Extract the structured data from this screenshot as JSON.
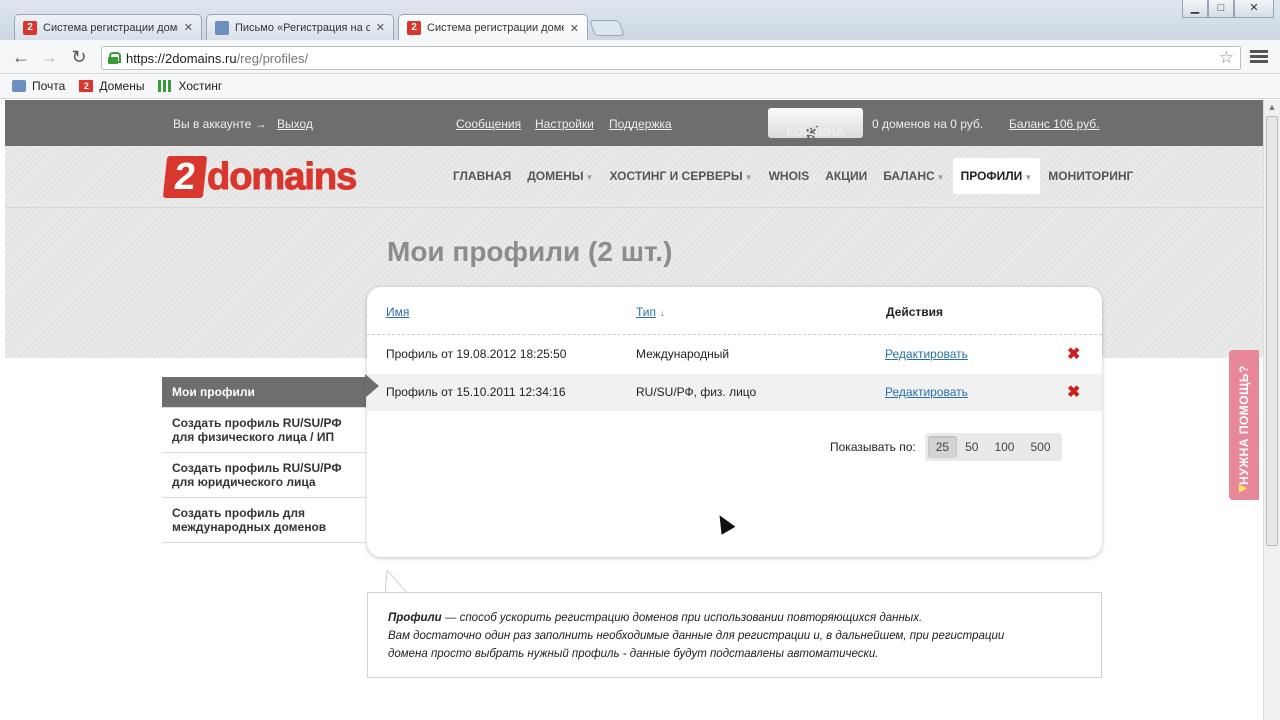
{
  "browser": {
    "tabs": [
      {
        "title": "Система регистрации доме",
        "icon": "two-icon",
        "active": false
      },
      {
        "title": "Письмо «Регистрация на с",
        "icon": "mail-icon",
        "active": false
      },
      {
        "title": "Система регистрации доме",
        "icon": "two-icon",
        "active": true
      }
    ],
    "favicon_letter": "2",
    "close_glyph": "✕",
    "window_controls": {
      "minimize": "▁",
      "maximize": "□",
      "close": "✕"
    },
    "url_host": "https://2domains.ru",
    "url_path": "/reg/profiles/",
    "bookmarks": [
      {
        "label": "Почта",
        "icon": "mail-icon"
      },
      {
        "label": "Домены",
        "icon": "two-icon"
      },
      {
        "label": "Хостинг",
        "icon": "hosting-icon"
      }
    ]
  },
  "topbar": {
    "account_text": "Вы в аккаунте →",
    "logout": "Выход",
    "messages": "Сообщения",
    "settings": "Настройки",
    "support": "Поддержка",
    "cart_label": "КОРЗИНА",
    "cart_summary": "0 доменов на 0 руб.",
    "balance": "Баланс 106 руб."
  },
  "logo": {
    "digit": "2",
    "text": "domains"
  },
  "nav": [
    {
      "label": "ГЛАВНАЯ",
      "caret": false
    },
    {
      "label": "ДОМЕНЫ",
      "caret": true
    },
    {
      "label": "ХОСТИНГ И СЕРВЕРЫ",
      "caret": true
    },
    {
      "label": "WHOIS",
      "caret": false
    },
    {
      "label": "АКЦИИ",
      "caret": false
    },
    {
      "label": "БАЛАНС",
      "caret": true
    },
    {
      "label": "ПРОФИЛИ",
      "caret": true,
      "active": true
    },
    {
      "label": "МОНИТОРИНГ",
      "caret": false
    }
  ],
  "page_title": "Мои профили (2 шт.)",
  "sidebar": [
    {
      "label": "Мои профили",
      "active": true
    },
    {
      "label": "Создать профиль RU/SU/РФ для физического лица / ИП"
    },
    {
      "label": "Создать профиль RU/SU/РФ для юридического лица"
    },
    {
      "label": "Создать профиль для международных доменов"
    }
  ],
  "table": {
    "headers": {
      "name": "Имя",
      "type": "Тип",
      "actions": "Действия"
    },
    "rows": [
      {
        "name": "Профиль от 19.08.2012 18:25:50",
        "type": "Международный",
        "action": "Редактировать"
      },
      {
        "name": "Профиль от 15.10.2011 12:34:16",
        "type": "RU/SU/РФ, физ. лицо",
        "action": "Редактировать"
      }
    ],
    "per_page_label": "Показывать по:",
    "per_page_options": [
      "25",
      "50",
      "100",
      "500"
    ],
    "per_page_selected": "25"
  },
  "info": {
    "term": "Профили",
    "line1": " — способ ускорить регистрацию доменов при использовании повторяющихся данных.",
    "line2": "Вам достаточно один раз заполнить необходимые данные для регистрации и, в дальнейшем, при регистрации",
    "line3": "домена просто выбрать нужный профиль - данные будут подставлены автоматически."
  },
  "help_tab": "НУЖНА ПОМОЩЬ?",
  "colors": {
    "brand": "#d9362e",
    "topbar": "#6e6e6e",
    "link": "#2a6fa8",
    "delete": "#cc1f1f",
    "help": "#e8869a"
  }
}
